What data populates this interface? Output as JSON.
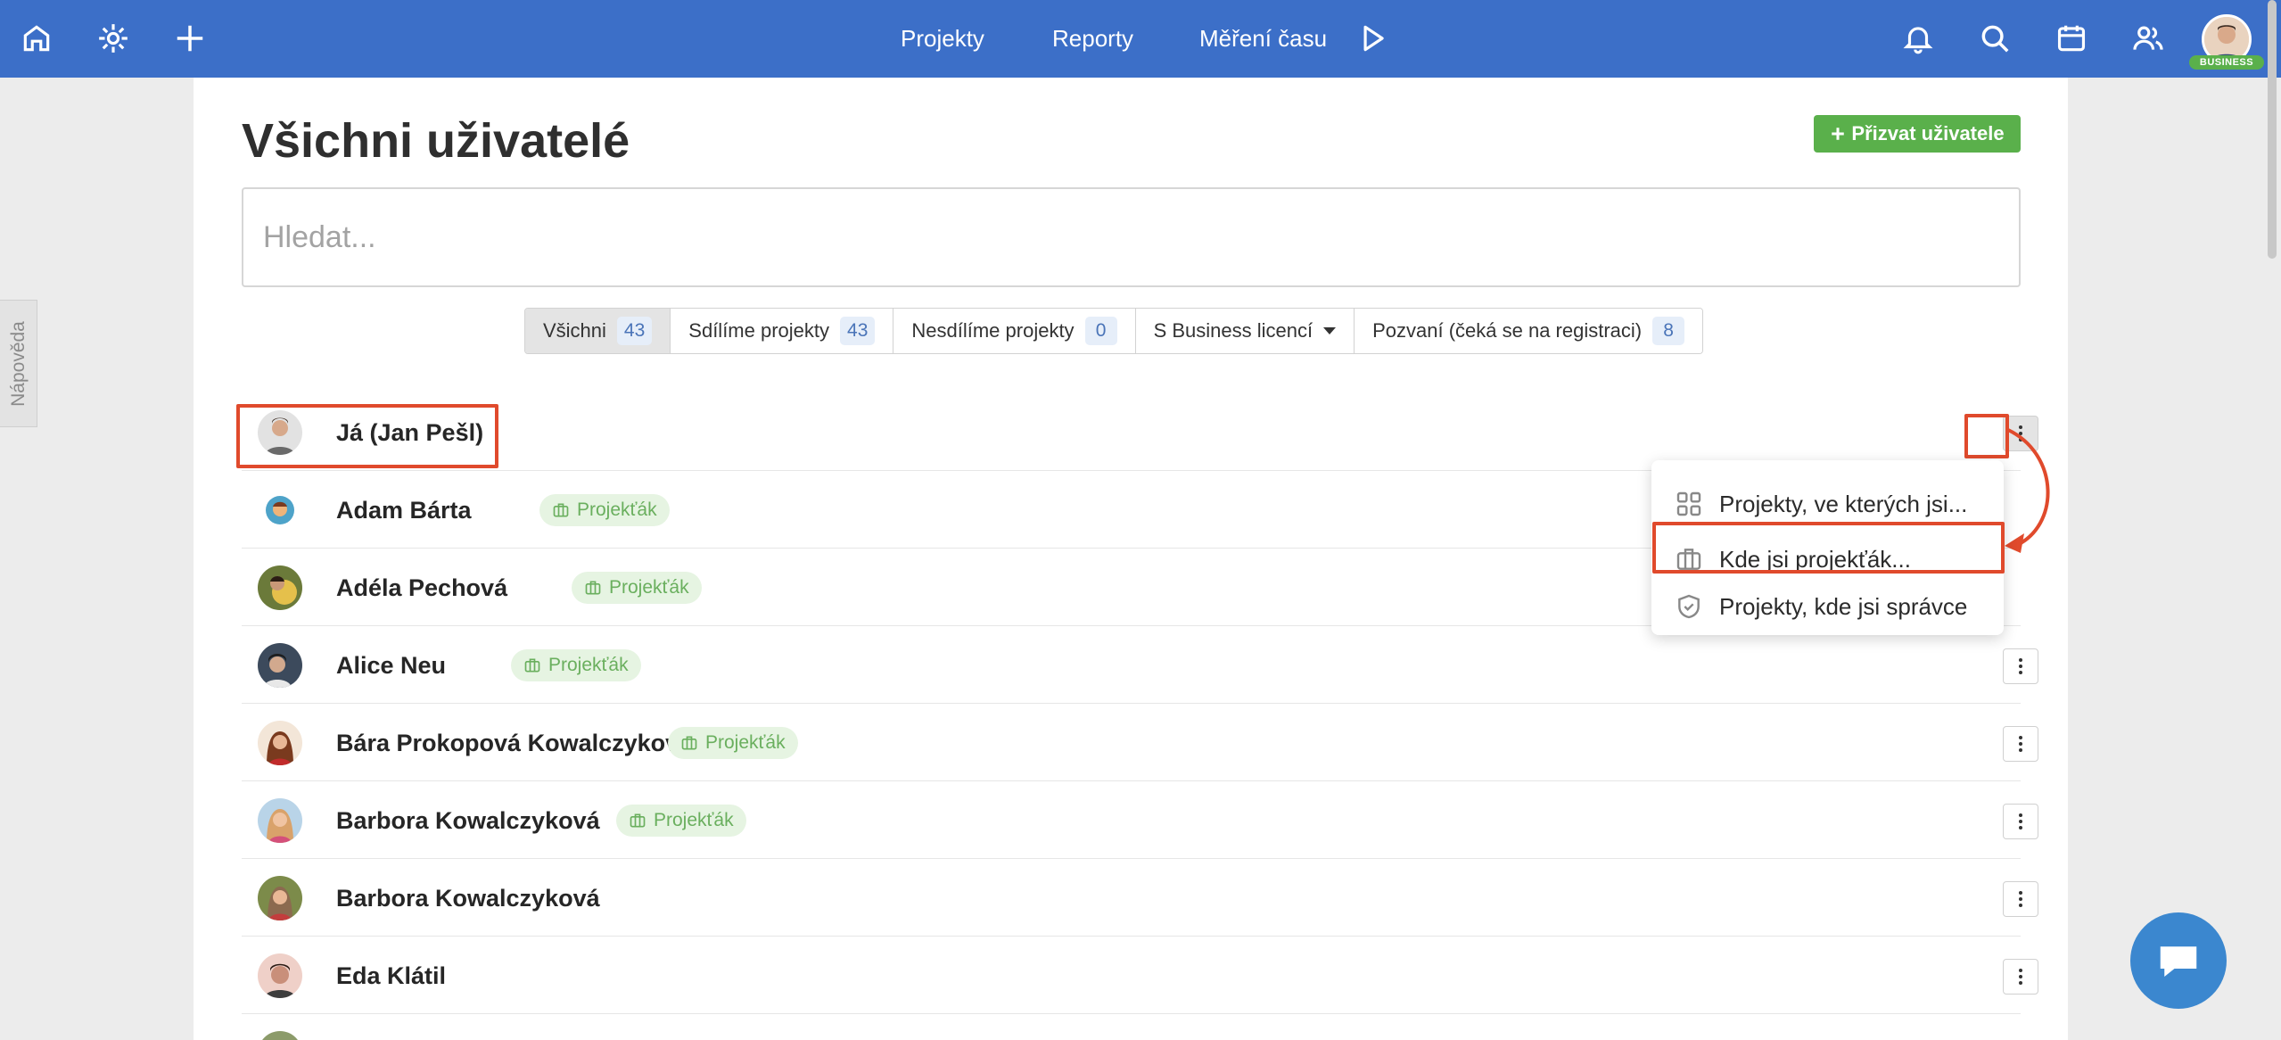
{
  "nav": {
    "links": [
      "Projekty",
      "Reporty",
      "Měření času"
    ],
    "badge": "BUSINESS",
    "icons": [
      "home-icon",
      "settings-icon",
      "plus-icon",
      "play-icon",
      "bell-icon",
      "search-icon",
      "calendar-icon",
      "users-icon"
    ]
  },
  "help_tab": "Nápověda",
  "page": {
    "title": "Všichni uživatelé",
    "invite_button": "Přizvat uživatele",
    "search_placeholder": "Hledat..."
  },
  "filters": [
    {
      "label": "Všichni",
      "count": "43",
      "active": true
    },
    {
      "label": "Sdílíme projekty",
      "count": "43",
      "active": false
    },
    {
      "label": "Nesdílíme projekty",
      "count": "0",
      "active": false
    },
    {
      "label": "S Business licencí",
      "count": "",
      "active": false
    },
    {
      "label": "Pozvaní (čeká se na registraci)",
      "count": "8",
      "active": false
    }
  ],
  "users": [
    {
      "name": "Já (Jan Pešl)",
      "tag": "",
      "avatar_color": "#c9b8a6"
    },
    {
      "name": "Adam Bárta",
      "tag": "Projekťák",
      "avatar_color": "#4ea3c9"
    },
    {
      "name": "Adéla Pechová",
      "tag": "Projekťák",
      "avatar_color": "#6b7a3a"
    },
    {
      "name": "Alice Neu",
      "tag": "Projekťák",
      "avatar_color": "#3c4a5c"
    },
    {
      "name": "Bára Prokopová Kowalczyková",
      "tag": "Projekťák",
      "avatar_color": "#a0522d"
    },
    {
      "name": "Barbora Kowalczyková",
      "tag": "Projekťák",
      "avatar_color": "#d9a26a"
    },
    {
      "name": "Barbora Kowalczyková",
      "tag": "",
      "avatar_color": "#8c6a4f"
    },
    {
      "name": "Eda Klátil",
      "tag": "",
      "avatar_color": "#b07a6a"
    }
  ],
  "menu": {
    "items": [
      {
        "label": "Projekty, ve kterých jsi...",
        "icon": "grid-icon"
      },
      {
        "label": "Kde jsi projekťák...",
        "icon": "briefcase-icon"
      },
      {
        "label": "Projekty, kde jsi správce",
        "icon": "shield-check-icon"
      }
    ]
  },
  "colors": {
    "nav_bg": "#3c6fc8",
    "accent_green": "#5ab04b",
    "highlight_red": "#e04a2c",
    "chat_blue": "#3b87cf"
  }
}
